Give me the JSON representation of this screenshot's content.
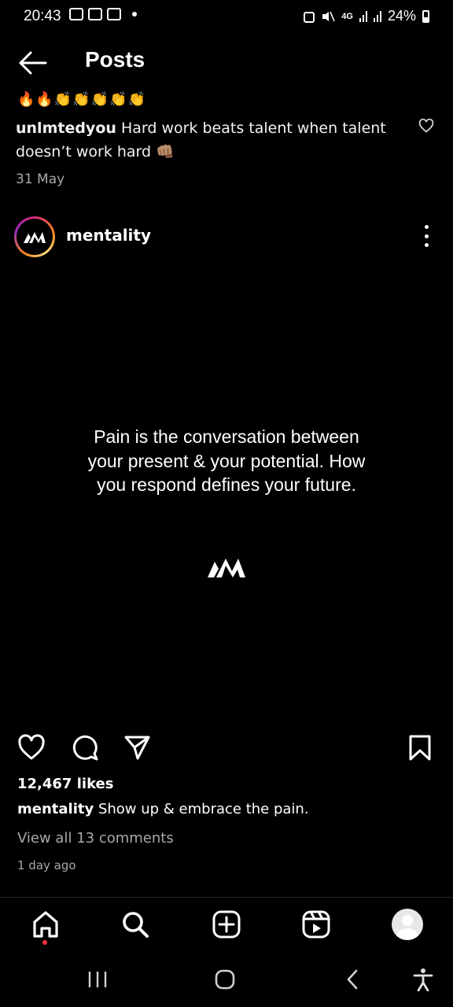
{
  "status_bar": {
    "time": "20:43",
    "network": "4G",
    "battery": "24%"
  },
  "header": {
    "title": "Posts"
  },
  "previous_post": {
    "emoji": "🔥🔥👏👏👏👏👏",
    "username": "unlmtedyou",
    "caption": "Hard work beats talent when talent doesn’t work hard 👊🏽",
    "date": "31 May"
  },
  "post": {
    "username": "mentality",
    "quote": "Pain is the conversation between your present & your potential. How you respond defines your future.",
    "likes": "12,467 likes",
    "caption_user": "mentality",
    "caption_text": "Show up & embrace the pain.",
    "view_comments": "View all 13 comments",
    "time_ago": "1 day ago"
  },
  "colors": {
    "background": "#000000",
    "text": "#f5f5f5",
    "muted": "#a8a8a8",
    "notification_dot": "#ff3040"
  }
}
